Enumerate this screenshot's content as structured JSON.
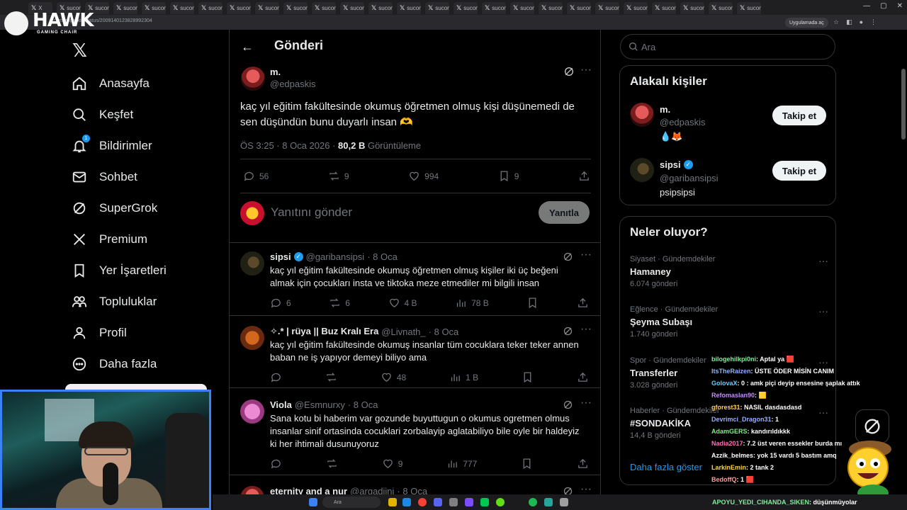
{
  "browser": {
    "tab_label": "sucom",
    "first_tab_label": "X",
    "tab_count": 26,
    "url": "x.com/edpaskis/status/2009140123828992304",
    "app_pill": "Uygulamada aç"
  },
  "overlay_logo": {
    "name": "HAWK",
    "sub": "GAMING CHAIR"
  },
  "nav": {
    "items": [
      {
        "label": "Anasayfa",
        "icon": "home-icon"
      },
      {
        "label": "Keşfet",
        "icon": "search-icon"
      },
      {
        "label": "Bildirimler",
        "icon": "bell-icon",
        "badge": "1"
      },
      {
        "label": "Sohbet",
        "icon": "mail-icon"
      },
      {
        "label": "SuperGrok",
        "icon": "grok-icon"
      },
      {
        "label": "Premium",
        "icon": "x-icon"
      },
      {
        "label": "Yer İşaretleri",
        "icon": "bookmark-icon"
      },
      {
        "label": "Topluluklar",
        "icon": "people-icon"
      },
      {
        "label": "Profil",
        "icon": "profile-icon"
      },
      {
        "label": "Daha fazla",
        "icon": "more-circle-icon"
      }
    ]
  },
  "header": {
    "title": "Gönderi",
    "back": "←"
  },
  "post": {
    "name": "m.",
    "handle": "@edpaskis",
    "text": "kaç yıl eğitim fakültesinde okumuş öğretmen olmuş kişi düşünemedi de sen düşündün bunu duyarlı insan 🫶",
    "time": "ÖS 3:25 · 8 Oca 2026 · ",
    "views": "80,2 B",
    "views_label": " Görüntüleme",
    "stats": {
      "replies": "56",
      "reposts": "9",
      "likes": "994",
      "bookmarks": "9"
    }
  },
  "reply_box": {
    "placeholder": "Yanıtını gönder",
    "button": "Yanıtla"
  },
  "replies": [
    {
      "name": "sipsi",
      "verified": true,
      "handle": "@garibansipsi",
      "date": "· 8 Oca",
      "text": "kaç yıl eğitim fakültesinde okumuş öğretmen olmuş kişiler iki üç beğeni almak için çocukları insta ve tiktoka meze etmediler mi bilgili insan",
      "stats": {
        "replies": "6",
        "reposts": "6",
        "likes": "4 B",
        "views": "78 B"
      }
    },
    {
      "name": "✧.* | rüya || Buz Kralı Era",
      "verified": false,
      "handle": "@Livnath_",
      "date": "· 8 Oca",
      "text": "kaç yıl eğitim fakültesinde okumuş insanlar tüm cocuklara teker teker annen baban ne iş yapıyor demeyi biliyo ama",
      "stats": {
        "replies": "",
        "reposts": "",
        "likes": "48",
        "views": "1 B"
      }
    },
    {
      "name": "Viola",
      "verified": false,
      "handle": "@Esmnurxy",
      "date": "· 8 Oca",
      "text": "Sana kotu bi haberim var gozunde buyuttugun o okumus ogretmen olmus insanlar sinif ortasinda cocuklari zorbalayip aglatabiliyo bile oyle bir haldeyiz ki her ihtimali dusunuyoruz",
      "stats": {
        "replies": "",
        "reposts": "",
        "likes": "9",
        "views": "777"
      }
    },
    {
      "name": "eternity and a nur",
      "verified": false,
      "handle": "@argadiini",
      "date": "· 8 Oca",
      "text": "",
      "stats": {}
    }
  ],
  "search": {
    "placeholder": "Ara"
  },
  "related": {
    "title": "Alakalı kişiler",
    "people": [
      {
        "name": "m.",
        "handle": "@edpaskis",
        "bio": "💧🦊",
        "follow": "Takip et",
        "verified": false
      },
      {
        "name": "sipsi",
        "handle": "@garibansipsi",
        "bio": "psipsipsi",
        "follow": "Takip et",
        "verified": true
      }
    ]
  },
  "trending": {
    "title": "Neler oluyor?",
    "items": [
      {
        "category": "Siyaset · Gündemdekiler",
        "name": "Hamaney",
        "count": "6.074 gönderi"
      },
      {
        "category": "Eğlence · Gündemdekiler",
        "name": "Şeyma Subaşı",
        "count": "1.740 gönderi"
      },
      {
        "category": "Spor · Gündemdekiler",
        "name": "Transferler",
        "count": "3.028 gönderi"
      },
      {
        "category": "Haberler · Gündemdekiler",
        "name": "#SONDAKİKA",
        "count": "14,4 B gönderi"
      }
    ],
    "more": "Daha fazla göster"
  },
  "chat": [
    {
      "user": "bilogehilkpi0ni",
      "msg": ": Aptal ya 🟥",
      "color": "#7cf09a"
    },
    {
      "user": "ItsTheRaizen",
      "msg": ": ÜSTE ÖDER MİSİN CANIM",
      "color": "#8ab4ff"
    },
    {
      "user": "GolovaX",
      "msg": ": 0 : amk piçi deyip ensesine şaplak attık",
      "color": "#5ad1ff"
    },
    {
      "user": "Refomaslan90",
      "msg": ": 🟨",
      "color": "#c58cff"
    },
    {
      "user": "gforest31",
      "msg": ": NASIL dasdasdasd",
      "color": "#ffd24a"
    },
    {
      "user": "Devrimci_Dragon31",
      "msg": ": 1",
      "color": "#9ab0ff"
    },
    {
      "user": "AdamGERS",
      "msg": ": kandırıldıkkk",
      "color": "#7ff07f"
    },
    {
      "user": "Nadia2017",
      "msg": ": 7.2 üst veren essekler burda mı",
      "color": "#ff6fb5"
    },
    {
      "user": "Azzik_belmes",
      "msg": ": yok 15 vardı 5 bastım amq",
      "color": "#ffffff"
    },
    {
      "user": "LarkinEmin",
      "msg": ": 2 tank 2",
      "color": "#ffd24a"
    },
    {
      "user": "BedoffQ",
      "msg": ": 1 🟥",
      "color": "#ff9a9a"
    }
  ],
  "taskbar_chat": {
    "user": "APOYU_YEDI_CIHANDA_SIKEN",
    "msg": ": düşünmüyolar"
  },
  "taskbar_search": "Ara",
  "colors": {
    "accent": "#1d9bf0",
    "border": "#2f3336",
    "muted": "#71767b",
    "text": "#e7e9ea"
  }
}
